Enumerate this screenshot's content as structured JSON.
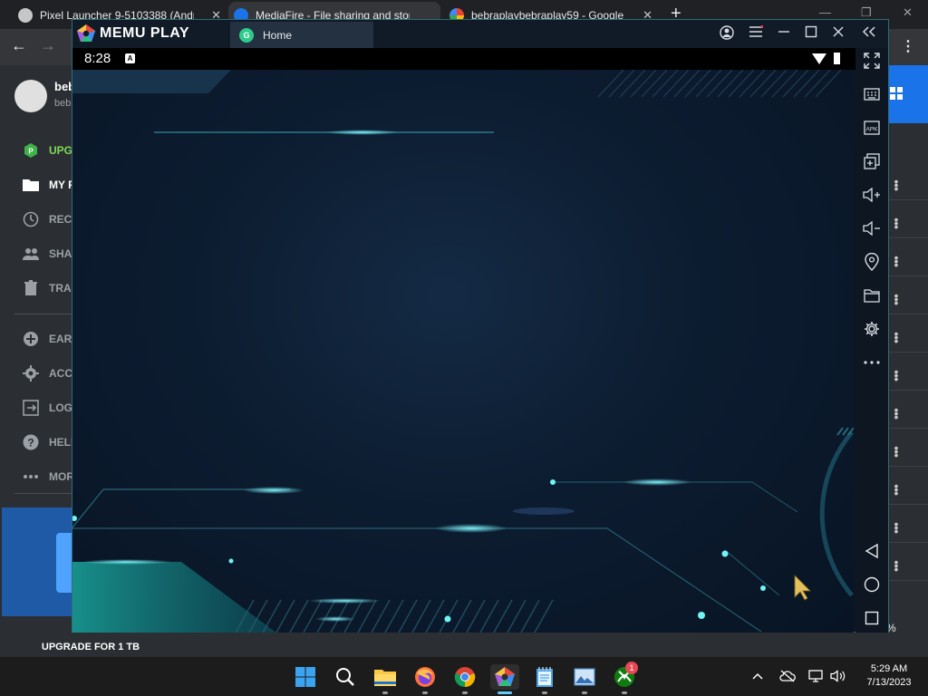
{
  "browser": {
    "tabs": [
      {
        "title": "Pixel Launcher 9-5103388 (Andr",
        "active": false
      },
      {
        "title": "MediaFire - File sharing and stora",
        "active": true
      },
      {
        "title": "bebraplaybebraplay59 - Google",
        "active": false
      }
    ],
    "close_glyph": "✕",
    "new_tab_glyph": "+"
  },
  "mediafire": {
    "user_name": "beb",
    "user_email": "beb",
    "nav": [
      {
        "label": "UPG",
        "icon": "upgrade-icon",
        "color": "#7ed957"
      },
      {
        "label": "MY F",
        "icon": "folder-icon",
        "color": "#ffffff"
      },
      {
        "label": "RECE",
        "icon": "clock-icon",
        "color": "#9aa0a6"
      },
      {
        "label": "SHA",
        "icon": "people-icon",
        "color": "#9aa0a6"
      },
      {
        "label": "TRAS",
        "icon": "trash-icon",
        "color": "#9aa0a6"
      },
      {
        "label": "EARN",
        "icon": "plus-circle-icon",
        "color": "#9aa0a6"
      },
      {
        "label": "ACCO",
        "icon": "gear-icon",
        "color": "#9aa0a6"
      },
      {
        "label": "LOG",
        "icon": "logout-icon",
        "color": "#9aa0a6"
      },
      {
        "label": "HELP",
        "icon": "help-icon",
        "color": "#9aa0a6"
      },
      {
        "label": "MOR",
        "icon": "more-icon",
        "color": "#9aa0a6"
      }
    ],
    "upgrade_banner": "UPGRADE FOR 1 TB",
    "percent_text": "%"
  },
  "memu": {
    "brand": "MEMU PLAY",
    "tab_label": "Home",
    "tab_icon_glyph": "G",
    "android_time": "8:28",
    "android_a": "A",
    "side_icons": [
      "fullscreen-icon",
      "keyboard-icon",
      "apk-icon",
      "multi-window-icon",
      "volume-up-icon",
      "volume-down-icon",
      "location-icon",
      "folder-icon",
      "settings-icon",
      "more-icon"
    ],
    "nav_icons": [
      "back-icon",
      "home-icon",
      "recents-icon"
    ],
    "apk_label": "APK"
  },
  "taskbar": {
    "apps": [
      "start-icon",
      "search-icon",
      "file-explorer-icon",
      "firefox-icon",
      "chrome-icon",
      "memu-icon",
      "notepad-icon",
      "photos-icon",
      "xbox-icon"
    ],
    "xbox_badge": "1",
    "time": "5:29 AM",
    "date": "7/13/2023"
  }
}
